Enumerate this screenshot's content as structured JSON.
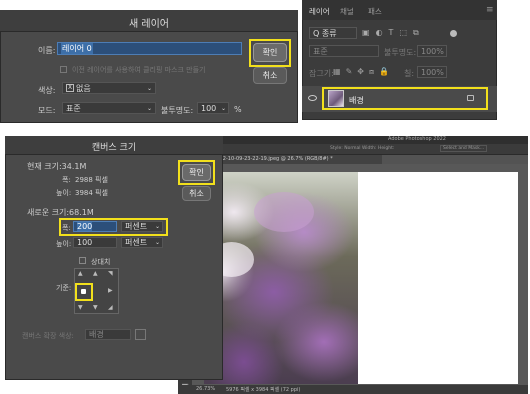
{
  "new_layer": {
    "title": "새 레이어",
    "name_label": "이름:",
    "name_value": "레이어 0",
    "clip_mask_label": "이전 레이어를 사용하여 클리핑 마스크 만들기",
    "color_label": "색상:",
    "color_value": "없음",
    "color_x": "X",
    "mode_label": "모드:",
    "mode_value": "표준",
    "opacity_label": "불투명도:",
    "opacity_value": "100",
    "opacity_unit": "%",
    "ok_label": "확인",
    "cancel_label": "취소"
  },
  "layers_panel": {
    "tabs": [
      "레이어",
      "채널",
      "패스"
    ],
    "search_placeholder": "Q 종류",
    "blend_mode": "표준",
    "opacity_label": "불투명도:",
    "opacity_value": "100%",
    "lock_label": "잠그기:",
    "fill_label": "칠:",
    "fill_value": "100%",
    "layer_name": "배경",
    "menu_glyph": "≡"
  },
  "canvas_size": {
    "title": "캔버스 크기",
    "current_size_label": "현재 크기:34.1M",
    "width_label": "폭:",
    "width_value": "2988 픽셀",
    "height_label": "높이:",
    "height_value": "3984 픽셀",
    "new_size_label": "새로운 크기:68.1M",
    "new_width_label": "폭:",
    "new_width_value": "200",
    "new_width_unit": "퍼센트",
    "new_height_label": "높이:",
    "new_height_value": "100",
    "new_height_unit": "퍼센트",
    "relative_label": "상대치",
    "anchor_label": "기준:",
    "ext_color_label": "캔버스 확장 색상:",
    "ext_color_value": "배경",
    "ok_label": "확인",
    "cancel_label": "취소"
  },
  "photoshop": {
    "app_title": "Adobe Photoshop 2022",
    "doc_tab": "_Photo_2022-10-09-23-22-19.jpeg @ 26.7% (RGB/8#) *",
    "zoom_value": "26.73%",
    "doc_info": "5976 픽셀 x 3984 픽셀 (72 ppi)",
    "options_bar": "Style: Normal  Width:  Height:",
    "select_mask_label": "Select and Mask..."
  }
}
